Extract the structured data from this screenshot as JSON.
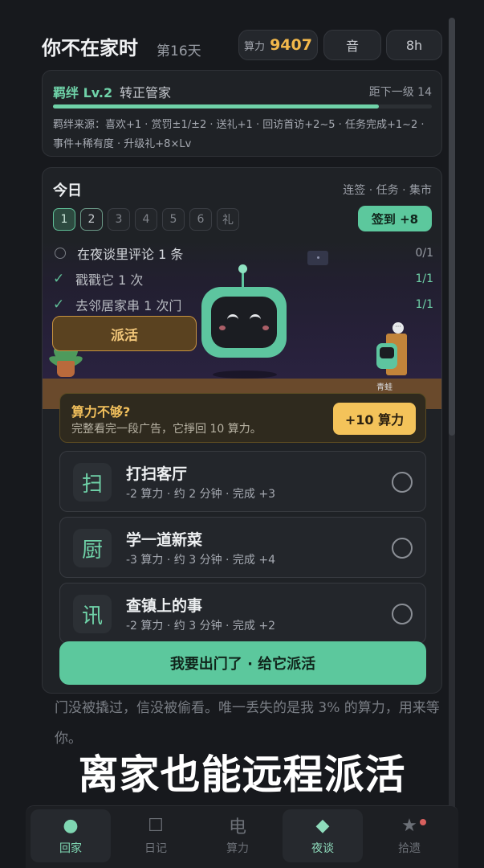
{
  "header": {
    "title": "你不在家时",
    "day": "第16天",
    "power_label": "算力",
    "power_value": "9407",
    "sound_label": "音",
    "time_label": "8h"
  },
  "bond": {
    "level": "羁绊 Lv.2",
    "role": "转正管家",
    "next": "距下一级 14",
    "progress_fraction": 0.86,
    "sources": "羁绊来源：喜欢+1 · 赏罚±1/±2 · 送礼+1 · 回访首访+2~5 · 任务完成+1~2 · 事件+稀有度 · 升级礼+8×Lv"
  },
  "today": {
    "title": "今日",
    "links": "连签 · 任务 · 集市",
    "days": [
      "1",
      "2",
      "3",
      "4",
      "5",
      "6",
      "礼"
    ],
    "checkin_label": "签到 +8",
    "tasks": [
      {
        "text": "在夜谈里评论 1 条",
        "progress": "0/1",
        "done": false
      },
      {
        "text": "戳戳它 1 次",
        "progress": "1/1",
        "done": true
      },
      {
        "text": "去邻居家串 1 次门",
        "progress": "1/1",
        "done": true
      }
    ],
    "check_mark": "✓",
    "dispatch_label": "派活",
    "neighbor_name": "青蛙",
    "neighbor_bubble": "···"
  },
  "ad": {
    "title": "算力不够?",
    "subtitle": "完整看完一段广告，它掙回 10 算力。",
    "button": "+10 算力"
  },
  "jobs": [
    {
      "icon_char": "扫",
      "name": "打扫客厅",
      "meta": "-2 算力 · 约 2 分钟 · 完成 +3"
    },
    {
      "icon_char": "厨",
      "name": "学一道新菜",
      "meta": "-3 算力 · 约 3 分钟 · 完成 +4"
    },
    {
      "icon_char": "讯",
      "name": "查镇上的事",
      "meta": "-2 算力 · 约 3 分钟 · 完成 +2"
    }
  ],
  "go_button": "我要出门了 · 给它派活",
  "story_text": "门没被撬过，信没被偷看。唯一丢失的是我 3% 的算力，用来等你。",
  "caption": "离家也能远程派活",
  "nav": [
    {
      "label": "回家",
      "icon": "home-circle-icon",
      "glyph": "●"
    },
    {
      "label": "日记",
      "icon": "diary-square-icon",
      "glyph": "☐"
    },
    {
      "label": "算力",
      "icon": "electric-icon",
      "glyph": "电"
    },
    {
      "label": "夜谈",
      "icon": "diamond-icon",
      "glyph": "◆"
    },
    {
      "label": "拾遗",
      "icon": "star-icon",
      "glyph": "★"
    }
  ],
  "colors": {
    "accent_green": "#5cc89d",
    "power_gold": "#f2b84b",
    "ad_button": "#f4c35a",
    "badge_red": "#d8605e"
  }
}
